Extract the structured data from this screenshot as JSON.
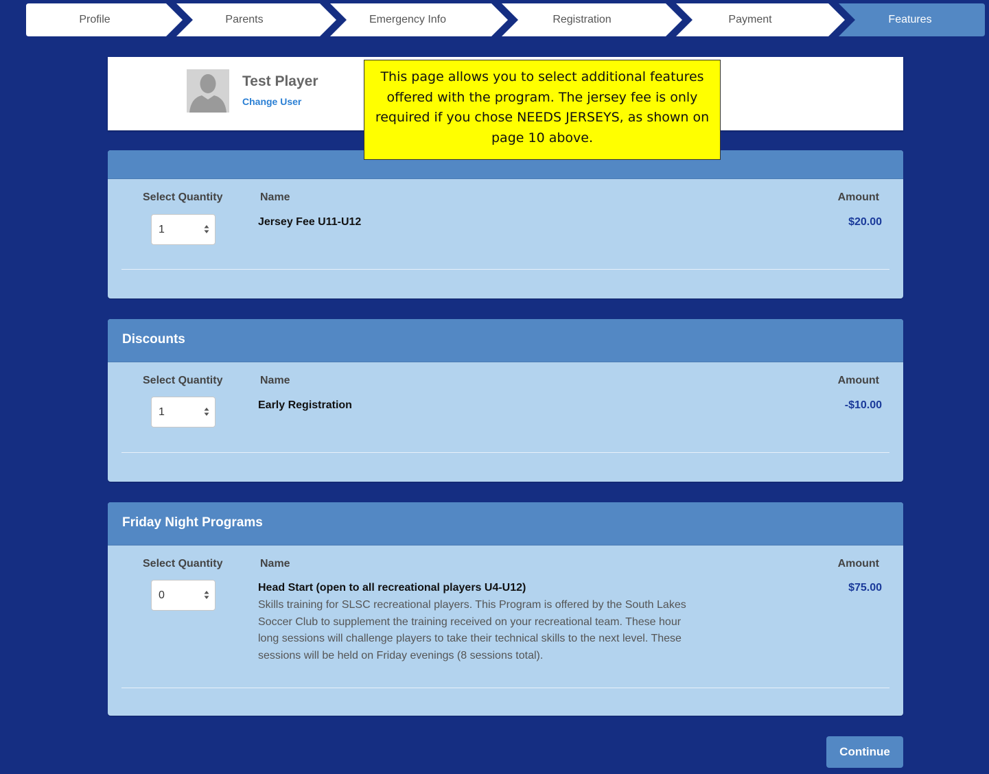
{
  "steps": [
    {
      "label": "Profile",
      "active": false
    },
    {
      "label": "Parents",
      "active": false
    },
    {
      "label": "Emergency Info",
      "active": false
    },
    {
      "label": "Registration",
      "active": false
    },
    {
      "label": "Payment",
      "active": false
    },
    {
      "label": "Features",
      "active": true
    }
  ],
  "user": {
    "name": "Test Player",
    "change_user_label": "Change User"
  },
  "note": {
    "text": "This page allows you to select additional features offered with the program. The jersey fee is only required if you chose NEEDS JERSEYS, as shown on page 10 above."
  },
  "columns": {
    "quantity": "Select Quantity",
    "name": "Name",
    "amount": "Amount"
  },
  "panels": [
    {
      "title": "",
      "items": [
        {
          "quantity": "1",
          "name": "Jersey Fee U11-U12",
          "description": "",
          "amount": "$20.00"
        }
      ]
    },
    {
      "title": "Discounts",
      "items": [
        {
          "quantity": "1",
          "name": "Early Registration",
          "description": "",
          "amount": "-$10.00"
        }
      ]
    },
    {
      "title": "Friday Night Programs",
      "items": [
        {
          "quantity": "0",
          "name": "Head Start (open to all recreational players U4-U12)",
          "description": "Skills training for SLSC recreational players. This Program is offered by the South Lakes Soccer Club to supplement the training received on your recreational team. These hour long sessions will challenge players to take their technical skills to the next level. These sessions will be held on Friday evenings (8 sessions total).",
          "amount": "$75.00"
        }
      ]
    }
  ],
  "continue_label": "Continue",
  "colors": {
    "background": "#152e82",
    "panel_header": "#5388c4",
    "panel_body": "#b3d3ee",
    "note_background": "#ffff00",
    "amount_text": "#1a3a9a",
    "link": "#2a7fd4"
  },
  "icons": [
    "user-avatar-icon",
    "select-updown-arrows-icon"
  ]
}
